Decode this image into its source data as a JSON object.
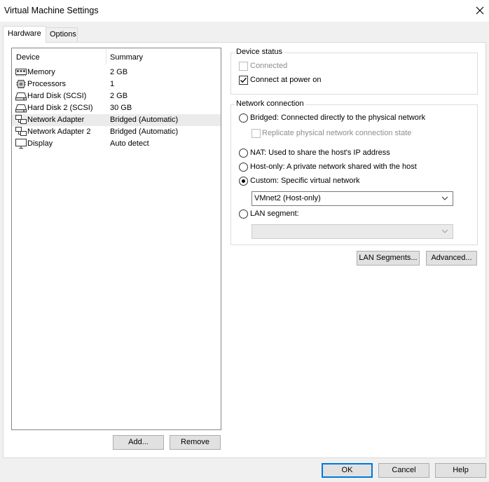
{
  "window": {
    "title": "Virtual Machine Settings"
  },
  "tabs": [
    {
      "label": "Hardware"
    },
    {
      "label": "Options"
    }
  ],
  "device_list": {
    "headers": {
      "device": "Device",
      "summary": "Summary"
    },
    "rows": [
      {
        "device": "Memory",
        "summary": "2 GB",
        "icon": "memory-icon"
      },
      {
        "device": "Processors",
        "summary": "1",
        "icon": "processor-icon"
      },
      {
        "device": "Hard Disk (SCSI)",
        "summary": "2 GB",
        "icon": "hard-disk-icon"
      },
      {
        "device": "Hard Disk 2 (SCSI)",
        "summary": "30 GB",
        "icon": "hard-disk-icon"
      },
      {
        "device": "Network Adapter",
        "summary": "Bridged (Automatic)",
        "icon": "network-adapter-icon",
        "selected": true
      },
      {
        "device": "Network Adapter 2",
        "summary": "Bridged (Automatic)",
        "icon": "network-adapter-icon"
      },
      {
        "device": "Display",
        "summary": "Auto detect",
        "icon": "display-icon"
      }
    ],
    "add_label": "Add...",
    "remove_label": "Remove"
  },
  "device_status": {
    "title": "Device status",
    "connected_label": "Connected",
    "connected_checked": false,
    "connected_enabled": false,
    "power_on_label": "Connect at power on",
    "power_on_checked": true
  },
  "network_connection": {
    "title": "Network connection",
    "bridged_label": "Bridged: Connected directly to the physical network",
    "replicate_label": "Replicate physical network connection state",
    "replicate_checked": false,
    "nat_label": "NAT: Used to share the host's IP address",
    "hostonly_label": "Host-only: A private network shared with the host",
    "custom_label": "Custom: Specific virtual network",
    "custom_value": "VMnet2 (Host-only)",
    "lan_label": "LAN segment:",
    "lan_value": "",
    "selected": "custom"
  },
  "lan_segments_label": "LAN Segments...",
  "advanced_label": "Advanced...",
  "footer": {
    "ok_label": "OK",
    "cancel_label": "Cancel",
    "help_label": "Help"
  },
  "colors": {
    "accent": "#0078d7",
    "selected_row": "#ebebeb",
    "disabled_text": "#8d8d8d"
  }
}
